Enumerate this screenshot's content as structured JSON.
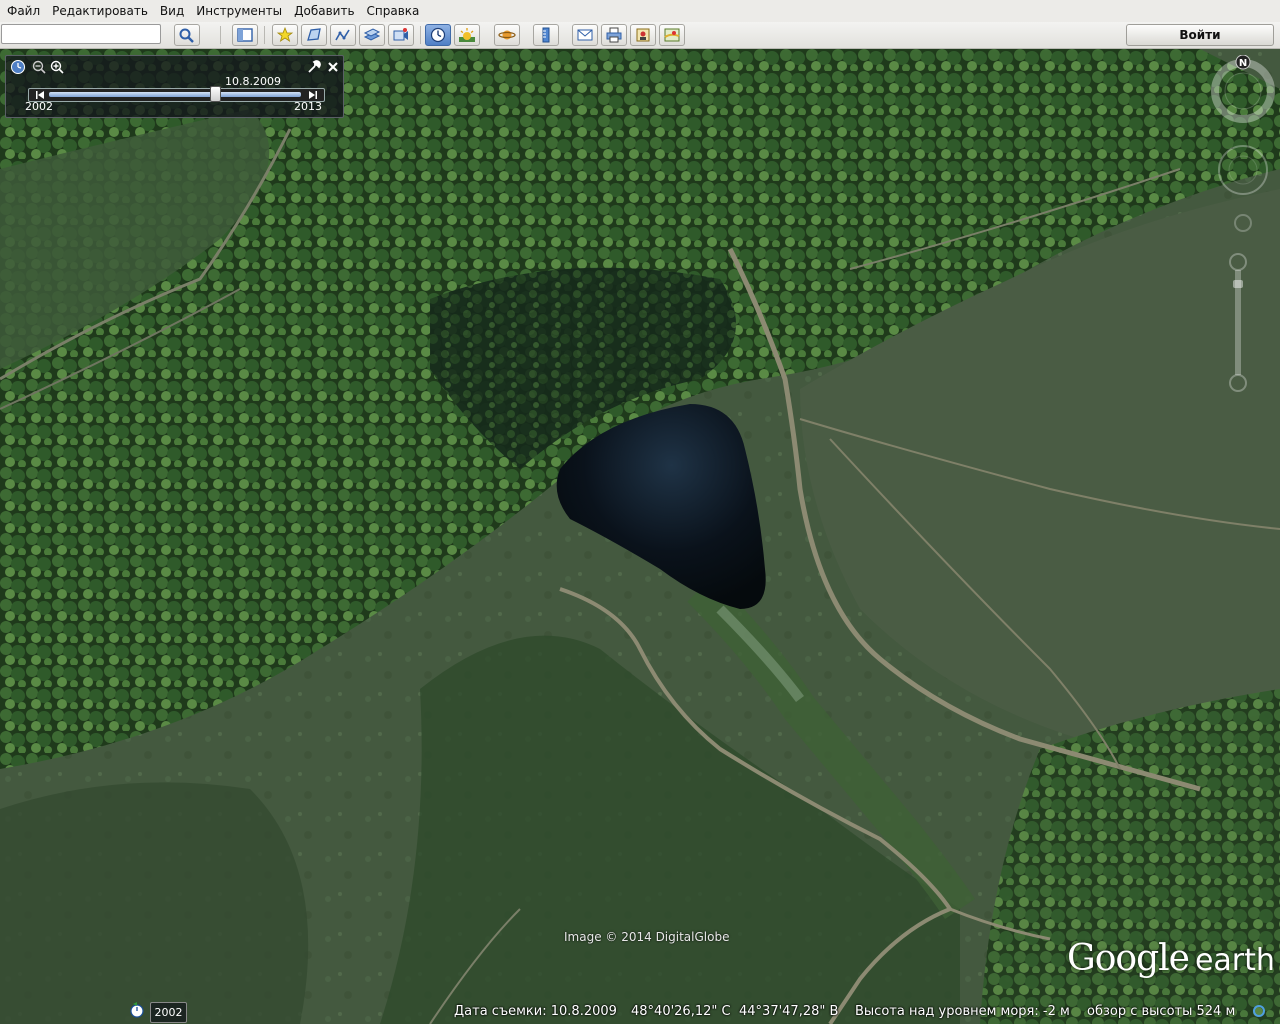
{
  "menu": [
    "Файл",
    "Редактировать",
    "Вид",
    "Инструменты",
    "Добавить",
    "Справка"
  ],
  "toolbar": {
    "search_value": "",
    "signin_label": "Войти",
    "buttons": [
      "search-icon",
      "sidebar-icon",
      "placemark-icon",
      "polygon-icon",
      "path-icon",
      "overlay-icon",
      "tour-icon",
      "historical-imagery-icon",
      "sunlight-icon",
      "planets-icon",
      "ruler-icon",
      "email-icon",
      "print-icon",
      "save-image-icon",
      "maps-icon"
    ],
    "active_button": "historical-imagery-icon"
  },
  "time_slider": {
    "current_date": "10.8.2009",
    "start_year": "2002",
    "end_year": "2013",
    "position": 0.66
  },
  "map": {
    "image_credit": "Image © 2014 DigitalGlobe",
    "logo_main": "Google",
    "logo_sub": "earth",
    "compass_label": "N"
  },
  "status": {
    "history_year": "2002",
    "capture_date": "Дата съемки: 10.8.2009",
    "latitude": "48°40'26,12\" С",
    "longitude": "44°37'47,28\" В",
    "elevation": "Высота над уровнем моря:   -2 м",
    "eye_alt": "обзор с высоты   524 м"
  }
}
